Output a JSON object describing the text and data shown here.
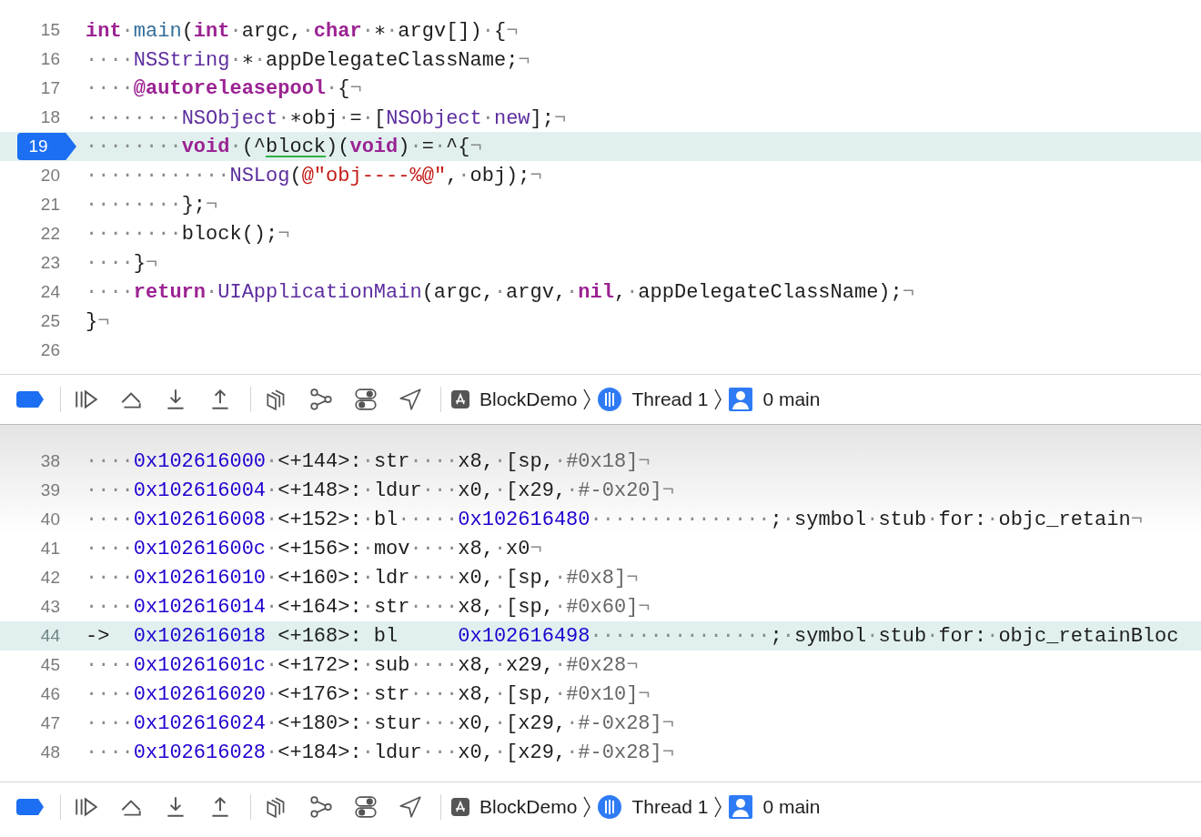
{
  "editor": {
    "lines": [
      {
        "number": "15",
        "current": false,
        "segments": [
          {
            "kind": "kw",
            "text": "int"
          },
          {
            "kind": "ws",
            "text": "·"
          },
          {
            "kind": "fn",
            "text": "main"
          },
          {
            "kind": "plain",
            "text": "("
          },
          {
            "kind": "kw",
            "text": "int"
          },
          {
            "kind": "ws",
            "text": "·"
          },
          {
            "kind": "plain",
            "text": "argc,"
          },
          {
            "kind": "ws",
            "text": "·"
          },
          {
            "kind": "kw",
            "text": "char"
          },
          {
            "kind": "ws",
            "text": "·"
          },
          {
            "kind": "plain",
            "text": "∗"
          },
          {
            "kind": "ws",
            "text": "·"
          },
          {
            "kind": "plain",
            "text": "argv[])"
          },
          {
            "kind": "ws",
            "text": "·"
          },
          {
            "kind": "plain",
            "text": "{"
          },
          {
            "kind": "ws",
            "text": "¬"
          }
        ]
      },
      {
        "number": "16",
        "current": false,
        "segments": [
          {
            "kind": "ws",
            "text": "····"
          },
          {
            "kind": "type",
            "text": "NSString"
          },
          {
            "kind": "ws",
            "text": "·"
          },
          {
            "kind": "plain",
            "text": "∗"
          },
          {
            "kind": "ws",
            "text": "·"
          },
          {
            "kind": "plain",
            "text": "appDelegateClassName;"
          },
          {
            "kind": "ws",
            "text": "¬"
          }
        ]
      },
      {
        "number": "17",
        "current": false,
        "segments": [
          {
            "kind": "ws",
            "text": "····"
          },
          {
            "kind": "kw",
            "text": "@autoreleasepool"
          },
          {
            "kind": "ws",
            "text": "·"
          },
          {
            "kind": "plain",
            "text": "{"
          },
          {
            "kind": "ws",
            "text": "¬"
          }
        ]
      },
      {
        "number": "18",
        "current": false,
        "segments": [
          {
            "kind": "ws",
            "text": "········"
          },
          {
            "kind": "type",
            "text": "NSObject"
          },
          {
            "kind": "ws",
            "text": "·"
          },
          {
            "kind": "plain",
            "text": "∗obj"
          },
          {
            "kind": "ws",
            "text": "·"
          },
          {
            "kind": "plain",
            "text": "="
          },
          {
            "kind": "ws",
            "text": "·"
          },
          {
            "kind": "plain",
            "text": "["
          },
          {
            "kind": "type",
            "text": "NSObject"
          },
          {
            "kind": "ws",
            "text": "·"
          },
          {
            "kind": "type",
            "text": "new"
          },
          {
            "kind": "plain",
            "text": "];"
          },
          {
            "kind": "ws",
            "text": "¬"
          }
        ]
      },
      {
        "number": "19",
        "current": true,
        "segments": [
          {
            "kind": "ws",
            "text": "········"
          },
          {
            "kind": "kw",
            "text": "void"
          },
          {
            "kind": "ws",
            "text": "·"
          },
          {
            "kind": "plain",
            "text": "(^"
          },
          {
            "kind": "underlined",
            "text": "block"
          },
          {
            "kind": "plain",
            "text": ")("
          },
          {
            "kind": "kw",
            "text": "void"
          },
          {
            "kind": "plain",
            "text": ")"
          },
          {
            "kind": "ws",
            "text": "·"
          },
          {
            "kind": "plain",
            "text": "="
          },
          {
            "kind": "ws",
            "text": "·"
          },
          {
            "kind": "plain",
            "text": "^{"
          },
          {
            "kind": "ws",
            "text": "¬"
          }
        ]
      },
      {
        "number": "20",
        "current": false,
        "segments": [
          {
            "kind": "ws",
            "text": "············"
          },
          {
            "kind": "type",
            "text": "NSLog"
          },
          {
            "kind": "plain",
            "text": "("
          },
          {
            "kind": "str",
            "text": "@\"obj----%@\""
          },
          {
            "kind": "plain",
            "text": ","
          },
          {
            "kind": "ws",
            "text": "·"
          },
          {
            "kind": "plain",
            "text": "obj);"
          },
          {
            "kind": "ws",
            "text": "¬"
          }
        ]
      },
      {
        "number": "21",
        "current": false,
        "segments": [
          {
            "kind": "ws",
            "text": "········"
          },
          {
            "kind": "plain",
            "text": "};"
          },
          {
            "kind": "ws",
            "text": "¬"
          }
        ]
      },
      {
        "number": "22",
        "current": false,
        "segments": [
          {
            "kind": "ws",
            "text": "········"
          },
          {
            "kind": "plain",
            "text": "block();"
          },
          {
            "kind": "ws",
            "text": "¬"
          }
        ]
      },
      {
        "number": "23",
        "current": false,
        "segments": [
          {
            "kind": "ws",
            "text": "····"
          },
          {
            "kind": "plain",
            "text": "}"
          },
          {
            "kind": "ws",
            "text": "¬"
          }
        ]
      },
      {
        "number": "24",
        "current": false,
        "segments": [
          {
            "kind": "ws",
            "text": "····"
          },
          {
            "kind": "kw",
            "text": "return"
          },
          {
            "kind": "ws",
            "text": "·"
          },
          {
            "kind": "type",
            "text": "UIApplicationMain"
          },
          {
            "kind": "plain",
            "text": "(argc,"
          },
          {
            "kind": "ws",
            "text": "·"
          },
          {
            "kind": "plain",
            "text": "argv,"
          },
          {
            "kind": "ws",
            "text": "·"
          },
          {
            "kind": "kw",
            "text": "nil"
          },
          {
            "kind": "plain",
            "text": ","
          },
          {
            "kind": "ws",
            "text": "·"
          },
          {
            "kind": "plain",
            "text": "appDelegateClassName);"
          },
          {
            "kind": "ws",
            "text": "¬"
          }
        ]
      },
      {
        "number": "25",
        "current": false,
        "segments": [
          {
            "kind": "plain",
            "text": "}"
          },
          {
            "kind": "ws",
            "text": "¬"
          }
        ]
      },
      {
        "number": "26",
        "current": false
      }
    ]
  },
  "debug_bars": [
    {
      "breakpoints_active": true,
      "crumbs": [
        {
          "kind": "app",
          "label": "BlockDemo"
        },
        {
          "kind": "thread",
          "label": "Thread 1"
        },
        {
          "kind": "frame",
          "label": "0 main"
        }
      ]
    },
    {
      "breakpoints_active": true,
      "crumbs": [
        {
          "kind": "app",
          "label": "BlockDemo"
        },
        {
          "kind": "thread",
          "label": "Thread 1"
        },
        {
          "kind": "frame",
          "label": "0 main"
        }
      ]
    }
  ],
  "disassembly": {
    "lines": [
      {
        "number": "38",
        "current": false,
        "segments": [
          {
            "kind": "ws",
            "text": "····"
          },
          {
            "kind": "addr",
            "text": "0x102616000"
          },
          {
            "kind": "ws",
            "text": "·"
          },
          {
            "kind": "plain",
            "text": "<+144>:"
          },
          {
            "kind": "ws",
            "text": "·"
          },
          {
            "kind": "plain",
            "text": "str"
          },
          {
            "kind": "ws",
            "text": "····"
          },
          {
            "kind": "plain",
            "text": "x8,"
          },
          {
            "kind": "ws",
            "text": "·"
          },
          {
            "kind": "plain",
            "text": "[sp,"
          },
          {
            "kind": "ws",
            "text": "·"
          },
          {
            "kind": "imm",
            "text": "#0x18]"
          },
          {
            "kind": "ws",
            "text": "¬"
          }
        ]
      },
      {
        "number": "39",
        "current": false,
        "segments": [
          {
            "kind": "ws",
            "text": "····"
          },
          {
            "kind": "addr",
            "text": "0x102616004"
          },
          {
            "kind": "ws",
            "text": "·"
          },
          {
            "kind": "plain",
            "text": "<+148>:"
          },
          {
            "kind": "ws",
            "text": "·"
          },
          {
            "kind": "plain",
            "text": "ldur"
          },
          {
            "kind": "ws",
            "text": "···"
          },
          {
            "kind": "plain",
            "text": "x0,"
          },
          {
            "kind": "ws",
            "text": "·"
          },
          {
            "kind": "plain",
            "text": "[x29,"
          },
          {
            "kind": "ws",
            "text": "·"
          },
          {
            "kind": "imm",
            "text": "#-0x20]"
          },
          {
            "kind": "ws",
            "text": "¬"
          }
        ]
      },
      {
        "number": "40",
        "current": false,
        "segments": [
          {
            "kind": "ws",
            "text": "····"
          },
          {
            "kind": "addr",
            "text": "0x102616008"
          },
          {
            "kind": "ws",
            "text": "·"
          },
          {
            "kind": "plain",
            "text": "<+152>:"
          },
          {
            "kind": "ws",
            "text": "·"
          },
          {
            "kind": "plain",
            "text": "bl"
          },
          {
            "kind": "ws",
            "text": "·····"
          },
          {
            "kind": "addr",
            "text": "0x102616480"
          },
          {
            "kind": "ws",
            "text": "···············"
          },
          {
            "kind": "plain",
            "text": ";"
          },
          {
            "kind": "ws",
            "text": "·"
          },
          {
            "kind": "plain",
            "text": "symbol"
          },
          {
            "kind": "ws",
            "text": "·"
          },
          {
            "kind": "plain",
            "text": "stub"
          },
          {
            "kind": "ws",
            "text": "·"
          },
          {
            "kind": "plain",
            "text": "for:"
          },
          {
            "kind": "ws",
            "text": "·"
          },
          {
            "kind": "plain",
            "text": "objc_retain"
          },
          {
            "kind": "ws",
            "text": "¬"
          }
        ]
      },
      {
        "number": "41",
        "current": false,
        "segments": [
          {
            "kind": "ws",
            "text": "····"
          },
          {
            "kind": "addr",
            "text": "0x10261600c"
          },
          {
            "kind": "ws",
            "text": "·"
          },
          {
            "kind": "plain",
            "text": "<+156>:"
          },
          {
            "kind": "ws",
            "text": "·"
          },
          {
            "kind": "plain",
            "text": "mov"
          },
          {
            "kind": "ws",
            "text": "····"
          },
          {
            "kind": "plain",
            "text": "x8,"
          },
          {
            "kind": "ws",
            "text": "·"
          },
          {
            "kind": "plain",
            "text": "x0"
          },
          {
            "kind": "ws",
            "text": "¬"
          }
        ]
      },
      {
        "number": "42",
        "current": false,
        "segments": [
          {
            "kind": "ws",
            "text": "····"
          },
          {
            "kind": "addr",
            "text": "0x102616010"
          },
          {
            "kind": "ws",
            "text": "·"
          },
          {
            "kind": "plain",
            "text": "<+160>:"
          },
          {
            "kind": "ws",
            "text": "·"
          },
          {
            "kind": "plain",
            "text": "ldr"
          },
          {
            "kind": "ws",
            "text": "····"
          },
          {
            "kind": "plain",
            "text": "x0,"
          },
          {
            "kind": "ws",
            "text": "·"
          },
          {
            "kind": "plain",
            "text": "[sp,"
          },
          {
            "kind": "ws",
            "text": "·"
          },
          {
            "kind": "imm",
            "text": "#0x8]"
          },
          {
            "kind": "ws",
            "text": "¬"
          }
        ]
      },
      {
        "number": "43",
        "current": false,
        "segments": [
          {
            "kind": "ws",
            "text": "····"
          },
          {
            "kind": "addr",
            "text": "0x102616014"
          },
          {
            "kind": "ws",
            "text": "·"
          },
          {
            "kind": "plain",
            "text": "<+164>:"
          },
          {
            "kind": "ws",
            "text": "·"
          },
          {
            "kind": "plain",
            "text": "str"
          },
          {
            "kind": "ws",
            "text": "····"
          },
          {
            "kind": "plain",
            "text": "x8,"
          },
          {
            "kind": "ws",
            "text": "·"
          },
          {
            "kind": "plain",
            "text": "[sp,"
          },
          {
            "kind": "ws",
            "text": "·"
          },
          {
            "kind": "imm",
            "text": "#0x60]"
          },
          {
            "kind": "ws",
            "text": "¬"
          }
        ]
      },
      {
        "number": "44",
        "current": true,
        "segments": [
          {
            "kind": "plain",
            "text": "->  "
          },
          {
            "kind": "addr",
            "text": "0x102616018"
          },
          {
            "kind": "plain",
            "text": " <+168>: bl     "
          },
          {
            "kind": "addr",
            "text": "0x102616498"
          },
          {
            "kind": "ws",
            "text": "···············"
          },
          {
            "kind": "plain",
            "text": ";"
          },
          {
            "kind": "ws",
            "text": "·"
          },
          {
            "kind": "plain",
            "text": "symbol"
          },
          {
            "kind": "ws",
            "text": "·"
          },
          {
            "kind": "plain",
            "text": "stub"
          },
          {
            "kind": "ws",
            "text": "·"
          },
          {
            "kind": "plain",
            "text": "for:"
          },
          {
            "kind": "ws",
            "text": "·"
          },
          {
            "kind": "plain",
            "text": "objc_retainBloc"
          }
        ]
      },
      {
        "number": "45",
        "current": false,
        "segments": [
          {
            "kind": "ws",
            "text": "····"
          },
          {
            "kind": "addr",
            "text": "0x10261601c"
          },
          {
            "kind": "ws",
            "text": "·"
          },
          {
            "kind": "plain",
            "text": "<+172>:"
          },
          {
            "kind": "ws",
            "text": "·"
          },
          {
            "kind": "plain",
            "text": "sub"
          },
          {
            "kind": "ws",
            "text": "····"
          },
          {
            "kind": "plain",
            "text": "x8,"
          },
          {
            "kind": "ws",
            "text": "·"
          },
          {
            "kind": "plain",
            "text": "x29,"
          },
          {
            "kind": "ws",
            "text": "·"
          },
          {
            "kind": "imm",
            "text": "#0x28"
          },
          {
            "kind": "ws",
            "text": "¬"
          }
        ]
      },
      {
        "number": "46",
        "current": false,
        "segments": [
          {
            "kind": "ws",
            "text": "····"
          },
          {
            "kind": "addr",
            "text": "0x102616020"
          },
          {
            "kind": "ws",
            "text": "·"
          },
          {
            "kind": "plain",
            "text": "<+176>:"
          },
          {
            "kind": "ws",
            "text": "·"
          },
          {
            "kind": "plain",
            "text": "str"
          },
          {
            "kind": "ws",
            "text": "····"
          },
          {
            "kind": "plain",
            "text": "x8,"
          },
          {
            "kind": "ws",
            "text": "·"
          },
          {
            "kind": "plain",
            "text": "[sp,"
          },
          {
            "kind": "ws",
            "text": "·"
          },
          {
            "kind": "imm",
            "text": "#0x10]"
          },
          {
            "kind": "ws",
            "text": "¬"
          }
        ]
      },
      {
        "number": "47",
        "current": false,
        "segments": [
          {
            "kind": "ws",
            "text": "····"
          },
          {
            "kind": "addr",
            "text": "0x102616024"
          },
          {
            "kind": "ws",
            "text": "·"
          },
          {
            "kind": "plain",
            "text": "<+180>:"
          },
          {
            "kind": "ws",
            "text": "·"
          },
          {
            "kind": "plain",
            "text": "stur"
          },
          {
            "kind": "ws",
            "text": "···"
          },
          {
            "kind": "plain",
            "text": "x0,"
          },
          {
            "kind": "ws",
            "text": "·"
          },
          {
            "kind": "plain",
            "text": "[x29,"
          },
          {
            "kind": "ws",
            "text": "·"
          },
          {
            "kind": "imm",
            "text": "#-0x28]"
          },
          {
            "kind": "ws",
            "text": "¬"
          }
        ]
      },
      {
        "number": "48",
        "current": false,
        "segments": [
          {
            "kind": "ws",
            "text": "····"
          },
          {
            "kind": "addr",
            "text": "0x102616028"
          },
          {
            "kind": "ws",
            "text": "·"
          },
          {
            "kind": "plain",
            "text": "<+184>:"
          },
          {
            "kind": "ws",
            "text": "·"
          },
          {
            "kind": "plain",
            "text": "ldur"
          },
          {
            "kind": "ws",
            "text": "···"
          },
          {
            "kind": "plain",
            "text": "x0,"
          },
          {
            "kind": "ws",
            "text": "·"
          },
          {
            "kind": "plain",
            "text": "[x29,"
          },
          {
            "kind": "ws",
            "text": "·"
          },
          {
            "kind": "imm",
            "text": "#-0x28]"
          },
          {
            "kind": "ws",
            "text": "¬"
          }
        ]
      }
    ]
  }
}
